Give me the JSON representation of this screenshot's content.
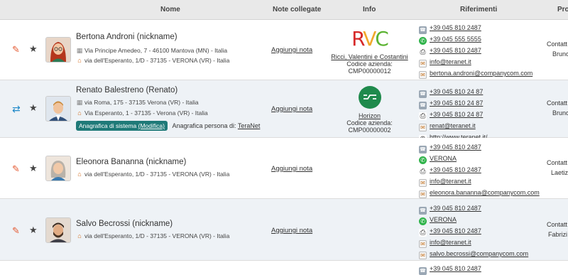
{
  "header": {
    "col_nome": "Nome",
    "col_note": "Note collegate",
    "col_info": "Info",
    "col_riferimenti": "Riferimenti",
    "col_pro": "Pro"
  },
  "colors": {
    "edit": "#e4572e",
    "accent": "#1f7a78",
    "header_bg": "#e9e9e9"
  },
  "rows": [
    {
      "action_icon": "pencil-icon",
      "name": "Bertona Androni (nickname)",
      "address_1": "Via Principe Amedeo, 7 - 46100 Mantova (MN) - Italia",
      "address_2": "via dell'Esperanto, 1/D - 37135 - VERONA (VR) - Italia",
      "note_link": "Aggiungi nota",
      "logo_text": "RVC",
      "company": "Ricci, Valentini e Costantini",
      "company_code": "Codice azienda: CMP00000012",
      "refs": [
        {
          "icon": "phone-icon",
          "text": "+39 045 810 2487"
        },
        {
          "icon": "whatsapp-icon",
          "text": "+39 045 555 5555"
        },
        {
          "icon": "fax-icon",
          "text": "+39 045 810 2487"
        },
        {
          "icon": "mail-icon",
          "text": "info@teranet.it"
        },
        {
          "icon": "mail-icon",
          "text": "bertona.androni@companycom.com"
        }
      ],
      "pro_1": "Contatt",
      "pro_2": "Bruno"
    },
    {
      "action_icon": "sync-icon",
      "name": "Renato Balestreno (Renato)",
      "address_1": "via Roma, 175 - 37135 Verona (VR) - Italia",
      "address_2": "Via Esperanto, 1 - 37135 - Verona (VR) - Italia",
      "badge": "Anagrafica di sistema",
      "badge_link": "(Modifica)",
      "anagrafica_label": "Anagrafica persona di:",
      "anagrafica_link": "TeraNet",
      "note_link": "Aggiungi nota",
      "company": "Horizon",
      "company_code": "Codice azienda: CMP00000002",
      "refs": [
        {
          "icon": "phone-icon",
          "text": "+39 045 810 24 87"
        },
        {
          "icon": "phone-icon",
          "text": "+39 045 810 24 87"
        },
        {
          "icon": "fax-icon",
          "text": "+39 045 810 24 87"
        },
        {
          "icon": "mail-icon",
          "text": "renat@teranet.it"
        },
        {
          "icon": "globe-icon",
          "text": "http://www.teranet.it/"
        }
      ],
      "pro_1": "Contatt",
      "pro_2": "Bruno"
    },
    {
      "action_icon": "pencil-icon",
      "name": "Eleonora Bananna (nickname)",
      "address_2": "via dell'Esperanto, 1/D - 37135 - VERONA (VR) - Italia",
      "note_link": "Aggiungi nota",
      "refs": [
        {
          "icon": "phone-icon",
          "text": "+39 045 810 2487"
        },
        {
          "icon": "whatsapp-icon",
          "text": "VERONA"
        },
        {
          "icon": "fax-icon",
          "text": "+39 045 810 2487"
        },
        {
          "icon": "mail-icon",
          "text": "info@teranet.it"
        },
        {
          "icon": "mail-icon",
          "text": "eleonora.bananna@companycom.com"
        }
      ],
      "pro_1": "Contatt",
      "pro_2": "Laetiz"
    },
    {
      "action_icon": "pencil-icon",
      "name": "Salvo Becrossi (nickname)",
      "address_2": "via dell'Esperanto, 1/D - 37135 - VERONA (VR) - Italia",
      "note_link": "Aggiungi nota",
      "refs": [
        {
          "icon": "phone-icon",
          "text": "+39 045 810 2487"
        },
        {
          "icon": "whatsapp-icon",
          "text": "VERONA"
        },
        {
          "icon": "fax-icon",
          "text": "+39 045 810 2487"
        },
        {
          "icon": "mail-icon",
          "text": "info@teranet.it"
        },
        {
          "icon": "mail-icon",
          "text": "salvo.becrossi@companycom.com"
        }
      ],
      "pro_1": "Contatt",
      "pro_2": "Fabrizi"
    },
    {
      "refs": [
        {
          "icon": "phone-icon",
          "text": "+39 045 810 2487"
        }
      ]
    }
  ]
}
